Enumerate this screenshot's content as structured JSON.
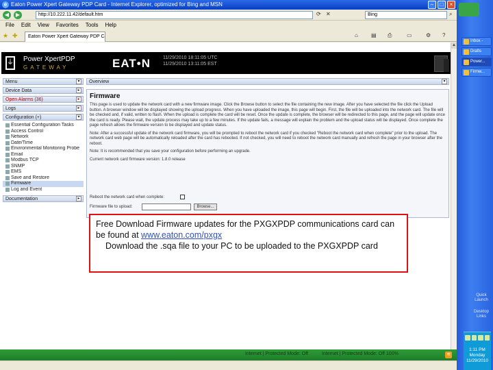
{
  "window": {
    "title": "Eaton Power Xpert Gateway PDP Card - Internet Explorer, optimized for Bing and MSN",
    "ie_icon": "e"
  },
  "address_bar": {
    "url": "http://10.222.11.42/default.htm",
    "search_value": "Bing"
  },
  "menu": [
    "File",
    "Edit",
    "View",
    "Favorites",
    "Tools",
    "Help"
  ],
  "tab": {
    "label": "Eaton Power Xpert Gateway PDP Card"
  },
  "header": {
    "brand_name": "Power XpertPDP",
    "brand_sub": "GATEWAY",
    "company": "EAT•N",
    "datetime_lines": [
      "11/29/2010 18:11:05 UTC",
      "11/29/2010 13:11:05 EST"
    ]
  },
  "nav": {
    "menu": "Menu",
    "device_data": "Device Data",
    "open_alarms": "Open Alarms (36)",
    "logs": "Logs",
    "configuration": "Configuration (+)",
    "tree": [
      "Essential Configuration Tasks",
      "Access Control",
      "Network",
      "Date/Time",
      "Environmental Monitoring Probe",
      "Email",
      "Modbus TCP",
      "SNMP",
      "EMS",
      "Save and Restore",
      "Firmware",
      "Log and Event"
    ],
    "selected_index": 10,
    "documentation": "Documentation"
  },
  "main": {
    "overview": "Overview",
    "fw_title": "Firmware",
    "paragraph1": "This page is used to update the network card with a new firmware image. Click the Browse button to select the file containing the new image. After you have selected the file click the Upload button. A browser window will be displayed showing the upload progress. When you have uploaded the image, this page will begin. First, the file will be uploaded into the network card. The file will be checked and, if valid, written to flash. When the upload is complete the card will be reset. Once the update is complete, the browser will be redirected to this page, and the page will update once the card is ready. Please wait, the update process may take up to a few minutes. If the update fails, a message will explain the problem and the upload status will be displayed. Once complete the page refresh allows the firmware version to be displayed and update status.",
    "paragraph2": "Note: After a successful update of the network card firmware, you will be prompted to reboot the network card if you checked \"Reboot the network card when complete\" prior to the upload. The network card web page will be automatically reloaded after the card has rebooted. If not checked, you will need to reboot the network card manually and refresh the page in your browser after the reboot.",
    "paragraph3": "Note: It is recommended that you save your configuration before performing an upgrade.",
    "current_version": "Current network card firmware version: 1.8.0 release",
    "reboot_label": "Reboot the network card when complete:",
    "upload_label": "Firmware file to upload:",
    "browse": "Browse..."
  },
  "callout": {
    "line1": "Free Download Firmware updates for the PXGXPDP communications card can be found at",
    "link": "www.eaton.com/pxgx",
    "line2": "Download the .sqa file to your PC to be uploaded to the PXGXPDP card"
  },
  "status": {
    "left": "Internet | Protected Mode: Off",
    "right": "Internet | Protected Mode: Off   100%"
  },
  "taskbar": {
    "items": [
      "Inbox -",
      "Drafts",
      "Power...",
      "Firmw..."
    ],
    "vertical_labels": [
      "Quick",
      "Launch",
      "Desktop",
      "Links"
    ],
    "clock_lines": [
      "1:11 PM",
      "Monday",
      "11/29/2010"
    ]
  }
}
